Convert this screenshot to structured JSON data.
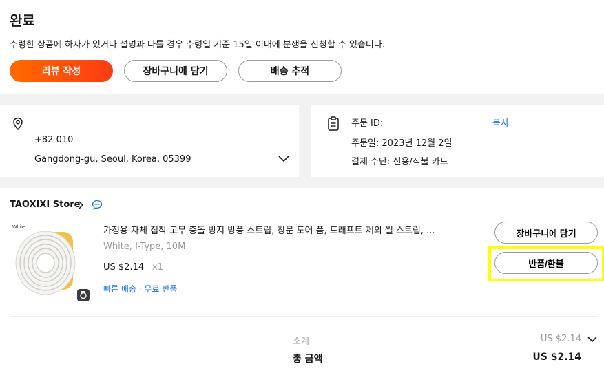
{
  "status": {
    "title": "완료",
    "description": "수령한 상품에 하자가 있거나 설명과 다를 경우 수령일 기준 15일 이내에 분쟁을 신청할 수 있습니다."
  },
  "actions": {
    "review": "리뷰 작성",
    "add_to_cart": "장바구니에 담기",
    "track": "배송 추적"
  },
  "address": {
    "phone": "+82 010",
    "line": "Gangdong-gu, Seoul, Korea, 05399"
  },
  "order": {
    "id_label": "주문 ID:",
    "copy": "복사",
    "date": "주문일: 2023년 12월 2일",
    "payment": "결제 수단: 신용/직불 카드"
  },
  "store": {
    "name": "TAOXIXI Store"
  },
  "product": {
    "image_label": "White",
    "title": "가정용 자체 접착 고무 충돌 방지 방풍 스트립, 창문 도어 폼, 드래프트 제외 씰 스트립, ...",
    "variant": "White, I-Type, 10M",
    "price": "US $2.14",
    "qty": "x1",
    "tags": "빠른 배송 · 무료 반품",
    "add_to_cart": "장바구니에 담기",
    "return_refund": "반품/환불"
  },
  "summary": {
    "subtotal_label": "소계",
    "subtotal_value": "US $2.14",
    "total_label": "총 금액",
    "total_value": "US $2.14"
  },
  "colors": {
    "accent_start": "#ff6a00",
    "accent_end": "#fd3b13",
    "link": "#1a73e8",
    "highlight": "#ffff00"
  }
}
